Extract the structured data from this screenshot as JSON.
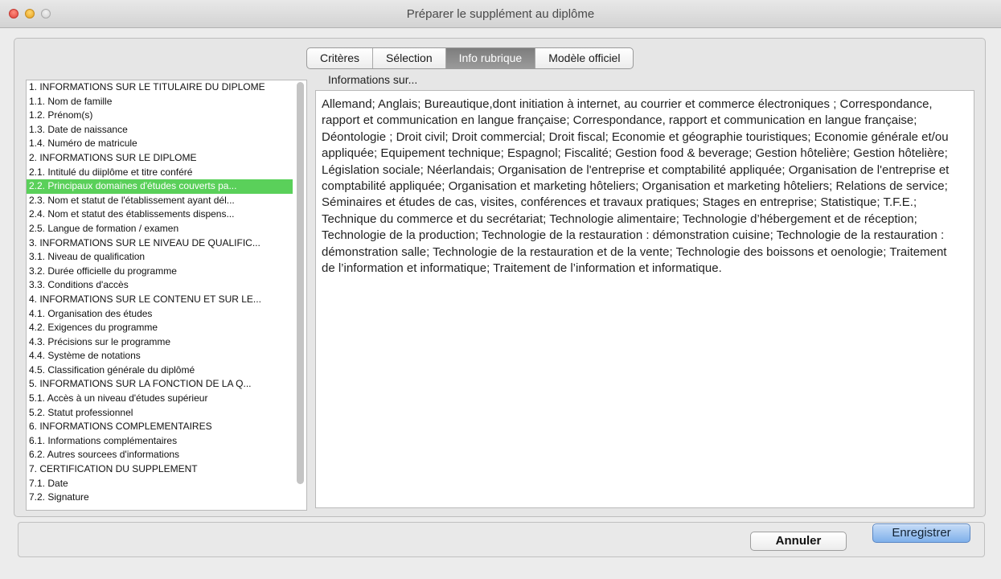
{
  "window": {
    "title": "Préparer le supplément au diplôme"
  },
  "tabs": [
    {
      "label": "Critères"
    },
    {
      "label": "Sélection"
    },
    {
      "label": "Info rubrique"
    },
    {
      "label": "Modèle officiel"
    }
  ],
  "active_tab": "Info rubrique",
  "sections": [
    {
      "label": "1. INFORMATIONS SUR LE TITULAIRE DU DIPLOME"
    },
    {
      "label": "1.1. Nom de famille"
    },
    {
      "label": "1.2. Prénom(s)"
    },
    {
      "label": "1.3. Date de naissance"
    },
    {
      "label": "1.4. Numéro de matricule"
    },
    {
      "label": "2. INFORMATIONS SUR LE DIPLOME"
    },
    {
      "label": "2.1. Intitulé du diiplôme et titre conféré"
    },
    {
      "label": "2.2. Principaux domaines d'études couverts pa..."
    },
    {
      "label": "2.3. Nom et statut de l'établissement ayant dél..."
    },
    {
      "label": "2.4. Nom et statut des établissements dispens..."
    },
    {
      "label": "2.5. Langue de formation / examen"
    },
    {
      "label": "3. INFORMATIONS SUR LE NIVEAU DE QUALIFIC..."
    },
    {
      "label": "3.1. Niveau de qualification"
    },
    {
      "label": "3.2. Durée officielle du programme"
    },
    {
      "label": "3.3. Conditions d'accès"
    },
    {
      "label": "4. INFORMATIONS SUR LE CONTENU ET SUR LE..."
    },
    {
      "label": "4.1. Organisation des études"
    },
    {
      "label": "4.2. Exigences du programme"
    },
    {
      "label": "4.3. Précisions sur le programme"
    },
    {
      "label": "4.4. Système de notations"
    },
    {
      "label": "4.5. Classification générale du diplômé"
    },
    {
      "label": "5. INFORMATIONS SUR LA FONCTION DE LA Q..."
    },
    {
      "label": "5.1. Accès à un niveau d'études supérieur"
    },
    {
      "label": "5.2. Statut professionnel"
    },
    {
      "label": "6. INFORMATIONS COMPLEMENTAIRES"
    },
    {
      "label": "6.1. Informations complémentaires"
    },
    {
      "label": "6.2. Autres sourcees d'informations"
    },
    {
      "label": "7. CERTIFICATION DU SUPPLEMENT"
    },
    {
      "label": "7.1. Date"
    },
    {
      "label": "7.2. Signature"
    }
  ],
  "selected_section": "2.2. Principaux domaines d'études couverts pa...",
  "info": {
    "label": "Informations sur...",
    "text": "Allemand; Anglais; Bureautique,dont initiation à internet, au courrier et commerce électroniques  ; Correspondance, rapport et communication en langue française; Correspondance, rapport et communication en langue française; Déontologie ; Droit civil; Droit commercial; Droit fiscal; Economie et géographie touristiques; Economie générale et/ou appliquée; Equipement technique; Espagnol; Fiscalité; Gestion food & beverage; Gestion hôtelière; Gestion hôtelière; Législation sociale; Néerlandais; Organisation de l'entreprise et comptabilité appliquée; Organisation de l'entreprise et comptabilité appliquée; Organisation et marketing hôteliers; Organisation et marketing hôteliers; Relations de service; Séminaires et études de cas, visites, conférences et travaux pratiques; Stages en entreprise; Statistique; T.F.E.; Technique du commerce et du secrétariat; Technologie alimentaire; Technologie d’hébergement et de réception; Technologie de la production; Technologie de la restauration : démonstration cuisine; Technologie de la restauration : démonstration salle; Technologie de la restauration et de la vente; Technologie des boissons et oenologie; Traitement de l’information et informatique; Traitement de l’information et informatique."
  },
  "buttons": {
    "cancel": "Annuler",
    "save": "Enregistrer"
  },
  "colors": {
    "selection": "#5ad05a",
    "default_button": "#7fb0ea",
    "active_tab": "#8a8a8a"
  }
}
